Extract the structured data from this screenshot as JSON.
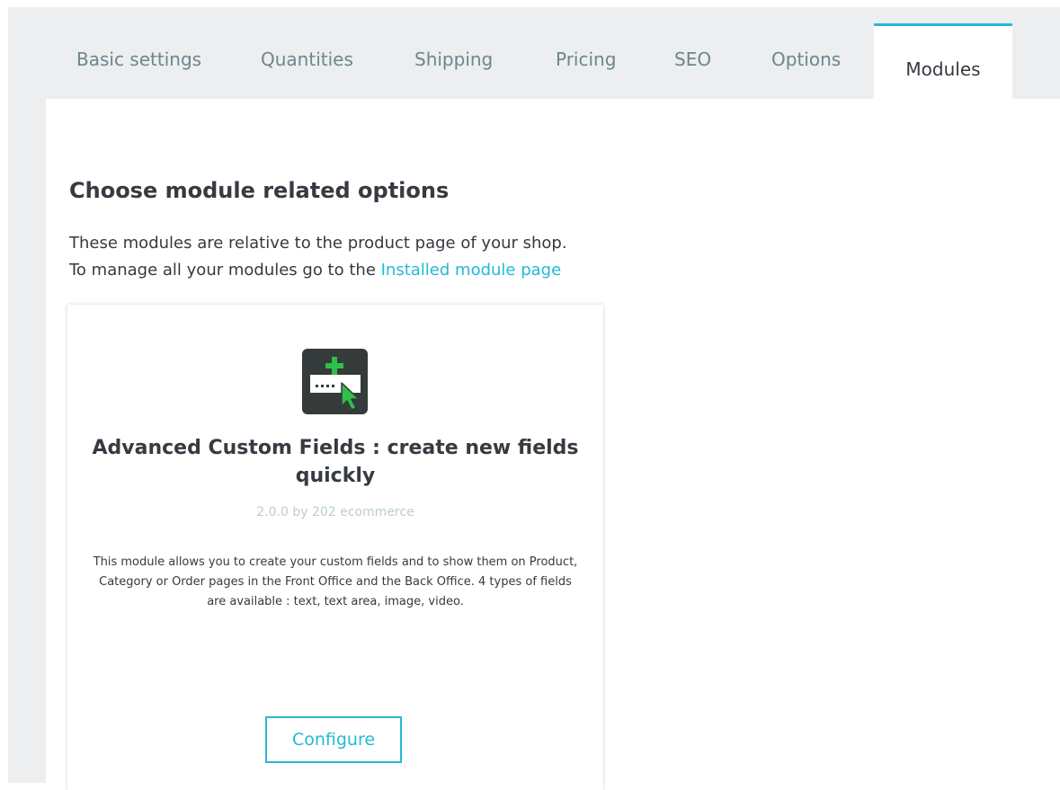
{
  "tabs": [
    {
      "label": "Basic settings"
    },
    {
      "label": "Quantities"
    },
    {
      "label": "Shipping"
    },
    {
      "label": "Pricing"
    },
    {
      "label": "SEO"
    },
    {
      "label": "Options"
    },
    {
      "label": "Modules",
      "active": true
    }
  ],
  "main": {
    "heading": "Choose module related options",
    "intro_line1": "These modules are relative to the product page of your shop.",
    "intro_line2_prefix": "To manage all your modules go to the ",
    "intro_link": "Installed module page"
  },
  "module": {
    "icon": "add-field-cursor-icon",
    "title": "Advanced Custom Fields : create new fields quickly",
    "version": "2.0.0 by 202 ecommerce",
    "description": "This module allows you to create your custom fields and to show them on Product, Category or Order pages in the Front Office and the Back Office. 4 types of fields are available : text, text area, image, video.",
    "configure_label": "Configure"
  },
  "colors": {
    "accent": "#25b9d7",
    "background": "#eceeef",
    "text": "#363a41",
    "muted": "#6c868e",
    "icon_green": "#2fbf4a"
  }
}
